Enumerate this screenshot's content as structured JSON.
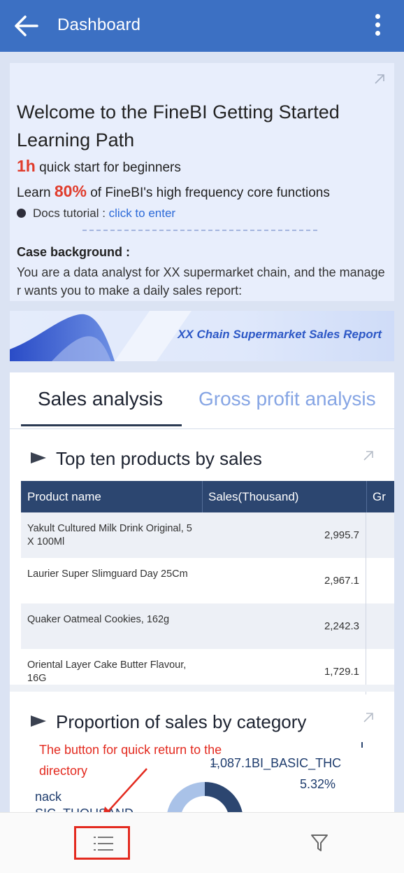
{
  "header": {
    "title": "Dashboard",
    "back_icon": "arrow-left-icon",
    "menu_icon": "more-vertical-icon",
    "color": "#3c70c3"
  },
  "welcome": {
    "title": "Welcome to the FineBI Getting Started Learning Path",
    "line1_highlight": "1h",
    "line1_text": " quick start for beginners",
    "line2_prefix": "Learn ",
    "line2_highlight": "80%",
    "line2_text": " of FineBI's high frequency core functions",
    "docs_label": "Docs tutorial : ",
    "docs_link": "click to enter",
    "case_title": "Case background :",
    "case_text": "You are a data analyst for XX supermarket chain, and the manager wants you to make a daily sales report:",
    "highlight_color": "#e03c2c"
  },
  "banner": {
    "text": "XX Chain Supermarket Sales Report"
  },
  "tabs": {
    "active": "Sales analysis",
    "inactive": "Gross profit analysis"
  },
  "top_products": {
    "title": "Top ten products by sales",
    "columns": [
      "Product name",
      "Sales(Thousand)",
      "Gr"
    ],
    "rows": [
      {
        "name": "Yakult Cultured Milk Drink Original, 5 X 100Ml",
        "sales": "2,995.7"
      },
      {
        "name": "Laurier Super Slimguard Day 25Cm",
        "sales": "2,967.1"
      },
      {
        "name": "Quaker Oatmeal Cookies, 162g",
        "sales": "2,242.3"
      },
      {
        "name": "Oriental Layer Cake Butter Flavour, 16G",
        "sales": "1,729.1"
      }
    ]
  },
  "category": {
    "title": "Proportion of sales by category",
    "label_value": "1,087.1BI_BASIC_THC",
    "label_percent": "5.32%",
    "label_left": "nack",
    "label_left2": "SIC_THOUSAND"
  },
  "annotation": {
    "text": "The button for quick return to the directory",
    "color": "#e32a1f"
  },
  "bottom_bar": {
    "directory_icon": "list-icon",
    "filter_icon": "filter-icon"
  }
}
